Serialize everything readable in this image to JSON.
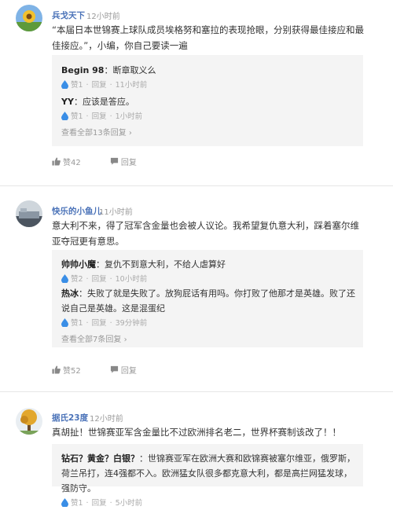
{
  "comments": [
    {
      "username": "兵戈天下",
      "time": "12小时前",
      "text": "“本届日本世锦赛上球队成员埃格努和塞拉的表现抢眼，分别获得最佳接应和最佳接应。”，小编，你自己要读一遍",
      "replies": [
        {
          "author": "Begin 98",
          "sep": "：",
          "text": "断章取义么",
          "likes": "赞1",
          "reply_label": "回复",
          "time": "11小时前"
        },
        {
          "author": "YY",
          "sep": "：",
          "text": "应该是答应。",
          "likes": "赞1",
          "reply_label": "回复",
          "time": "1小时前"
        }
      ],
      "more": "查看全部13条回复",
      "like_count": "赞42",
      "reply_label": "回复"
    },
    {
      "username": "快乐的小鱼儿",
      "time": "11小时前",
      "text": "意大利不来，得了冠军含金量也会被人议论。我希望复仇意大利，踩着塞尔维亚夺冠更有意思。",
      "replies": [
        {
          "author": "帅帅小魔",
          "sep": "：",
          "text": "复仇不到意大利，不给人虐算好",
          "likes": "赞2",
          "reply_label": "回复",
          "time": "10小时前"
        },
        {
          "author": "热冰",
          "sep": "：",
          "text": "失败了就是失败了。放狗屁话有用吗。你打败了他那才是英雄。败了还说自己是英雄。这是混蛋纪",
          "likes": "赞1",
          "reply_label": "回复",
          "time": "39分钟前"
        }
      ],
      "more": "查看全部7条回复",
      "like_count": "赞52",
      "reply_label": "回复"
    },
    {
      "username": "据氏23度",
      "time": "12小时前",
      "text": "真胡扯！世锦赛亚军含金量比不过欧洲排名老二，世界杯赛制该改了！！",
      "replies": [
        {
          "author": "钻石？黄金？白银？",
          "sep": "：",
          "text": "世锦赛亚军在欧洲大赛和欧锦赛被塞尔维亚，俄罗斯，荷兰吊打，连4强都不入。欧洲猛女队很多都克意大利，都是高拦网猛发球，强防守。",
          "likes": "赞1",
          "reply_label": "回复",
          "time": "5小时前"
        }
      ]
    }
  ],
  "colors": {
    "username": "#4a72b8",
    "like_drop": "#3a8ee6",
    "reply_bg": "#f4f4f4"
  }
}
